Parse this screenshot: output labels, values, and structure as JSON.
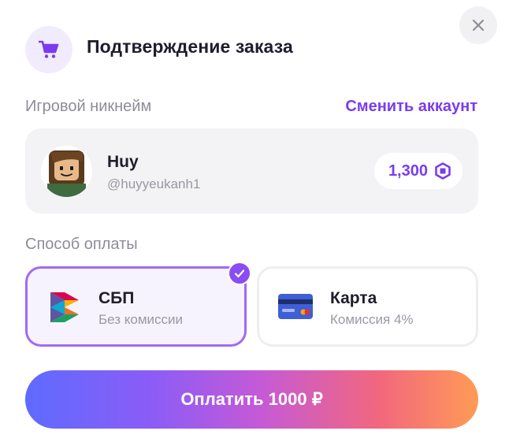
{
  "header": {
    "title": "Подтверждение заказа",
    "icon": "cart-icon",
    "close_icon": "close-icon"
  },
  "account": {
    "section_label": "Игровой никнейм",
    "switch_link": "Сменить аккаунт",
    "name": "Huy",
    "handle": "@huyyeukanh1",
    "balance": "1,300",
    "balance_icon": "robux-icon"
  },
  "payment": {
    "section_label": "Способ оплаты",
    "selected": "sbp",
    "options": [
      {
        "id": "sbp",
        "title": "СБП",
        "subtitle": "Без комиссии",
        "icon": "sbp-logo-icon"
      },
      {
        "id": "card",
        "title": "Карта",
        "subtitle": "Комиссия 4%",
        "icon": "credit-card-icon"
      }
    ]
  },
  "pay_button": {
    "label": "Оплатить 1000 ₽"
  },
  "colors": {
    "accent": "#7a3cf0",
    "selected_border": "#a06bf2",
    "card_bg": "#f3f3f6",
    "gradient_start": "#5f6bff",
    "gradient_end": "#ff9b55"
  }
}
